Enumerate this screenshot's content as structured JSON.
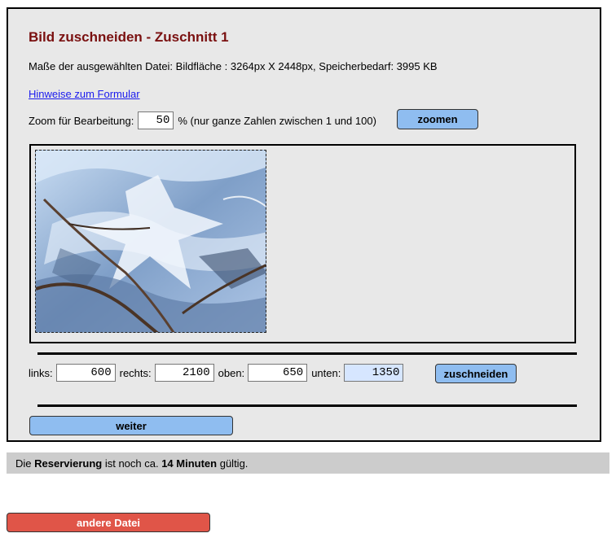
{
  "title": "Bild zuschneiden - Zuschnitt 1",
  "info": "Maße der ausgewählten Datei: Bildfläche : 3264px X 2448px, Speicherbedarf: 3995 KB",
  "help_link": "Hinweise zum Formular",
  "zoom": {
    "label": "Zoom für Bearbeitung:",
    "value": "50",
    "hint": "% (nur ganze Zahlen zwischen 1 und 100)",
    "button": "zoomen"
  },
  "coords": {
    "left_label": "links:",
    "left_value": "600",
    "right_label": "rechts:",
    "right_value": "2100",
    "top_label": "oben:",
    "top_value": "650",
    "bottom_label": "unten:",
    "bottom_value": "1350",
    "crop_button": "zuschneiden"
  },
  "next_button": "weiter",
  "status": {
    "prefix": "Die ",
    "bold1": "Reservierung",
    "middle": " ist noch ca. ",
    "bold2": "14 Minuten",
    "suffix": " gültig."
  },
  "other_button": "andere Datei",
  "colors": {
    "title": "#7a1010",
    "blue_button": "#8fbdf0",
    "red_button": "#e05548",
    "panel": "#e8e8e8"
  },
  "image": {
    "icon": "ice-crystal-photo"
  }
}
